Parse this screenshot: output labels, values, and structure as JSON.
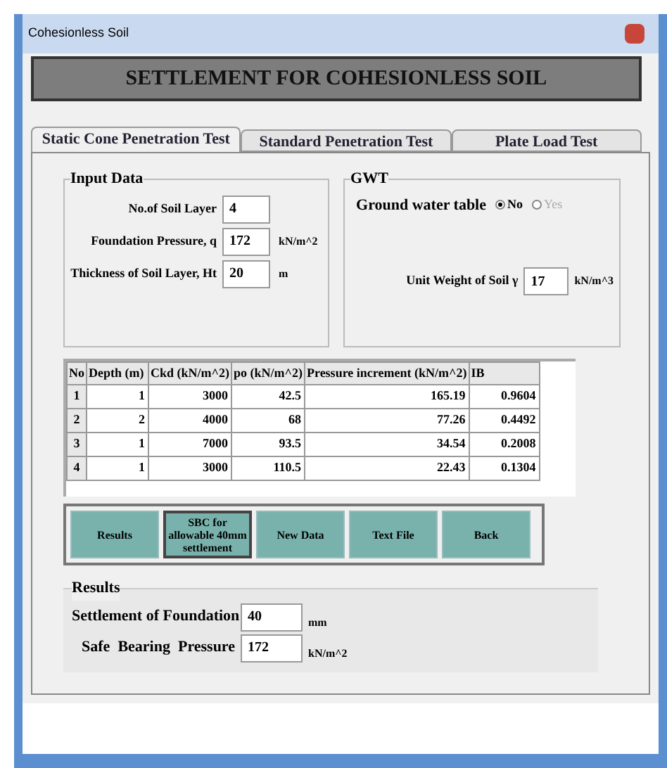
{
  "window": {
    "title": "Cohesionless Soil"
  },
  "header": "SETTLEMENT FOR COHESIONLESS SOIL",
  "tabs": [
    {
      "label": "Static Cone Penetration Test",
      "selected": true
    },
    {
      "label": "Standard Penetration Test",
      "selected": false
    },
    {
      "label": "Plate Load Test",
      "selected": false
    }
  ],
  "input_data": {
    "title": "Input Data",
    "fields": [
      {
        "label": "No.of Soil Layer",
        "value": "4"
      },
      {
        "label": "Foundation Pressure, q",
        "value": "172",
        "unit": "kN/m^2"
      },
      {
        "label": "Thickness of Soil Layer, Ht",
        "value": "20",
        "unit": "m"
      }
    ]
  },
  "gwt": {
    "title": "GWT",
    "label": "Ground water table",
    "options": [
      {
        "label": "No",
        "selected": true,
        "disabled": false
      },
      {
        "label": "Yes",
        "selected": false,
        "disabled": true
      }
    ],
    "unit_weight": {
      "label": "Unit Weight of Soil  γ",
      "value": "17",
      "unit": "kN/m^3"
    }
  },
  "table": {
    "columns": [
      "No",
      "Depth (m)",
      "Ckd (kN/m^2)",
      "po (kN/m^2)",
      "Pressure increment (kN/m^2)",
      "IB"
    ],
    "rows": [
      [
        "1",
        "1",
        "3000",
        "42.5",
        "165.19",
        "0.9604"
      ],
      [
        "2",
        "2",
        "4000",
        "68",
        "77.26",
        "0.4492"
      ],
      [
        "3",
        "1",
        "7000",
        "93.5",
        "34.54",
        "0.2008"
      ],
      [
        "4",
        "1",
        "3000",
        "110.5",
        "22.43",
        "0.1304"
      ]
    ]
  },
  "buttons": [
    {
      "label": "Results",
      "selected": false
    },
    {
      "label": "SBC for allowable 40mm settlement",
      "selected": true
    },
    {
      "label": "New Data",
      "selected": false
    },
    {
      "label": "Text File",
      "selected": false
    },
    {
      "label": "Back",
      "selected": false
    }
  ],
  "results": {
    "title": "Results",
    "fields": [
      {
        "label": "Settlement of Foundation",
        "value": "40",
        "unit": "mm"
      },
      {
        "label": "Safe  Bearing  Pressure",
        "value": "172",
        "unit": "kN/m^2"
      }
    ]
  }
}
